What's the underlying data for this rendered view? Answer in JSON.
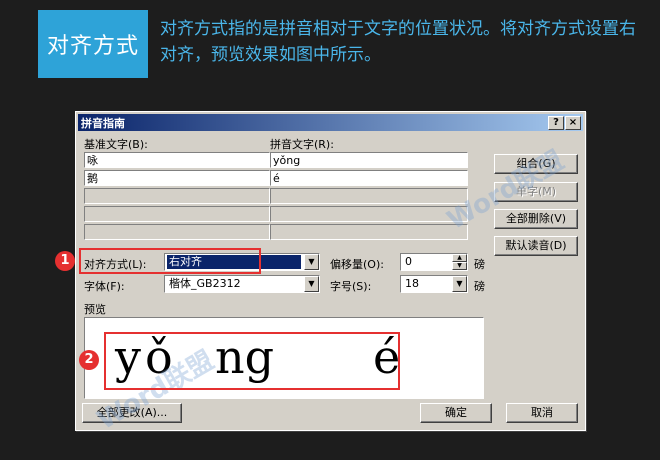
{
  "banner": {
    "tag": "对齐方式",
    "description": "对齐方式指的是拼音相对于文字的位置状况。将对齐方式设置右对齐，预览效果如图中所示。"
  },
  "dialog": {
    "title": "拼音指南",
    "help_btn": "?",
    "close_btn": "×",
    "base_text_header": "基准文字(B):",
    "ruby_text_header": "拼音文字(R):",
    "rows": [
      {
        "base": "咏",
        "ruby": "yǒng"
      },
      {
        "base": "鹅",
        "ruby": "é"
      }
    ],
    "buttons": {
      "combine": "组合(G)",
      "single": "单字(M)",
      "clear_all": "全部删除(V)",
      "default_reading": "默认读音(D)",
      "change_all": "全部更改(A)...",
      "ok": "确定",
      "cancel": "取消"
    },
    "alignment": {
      "label": "对齐方式(L):",
      "value": "右对齐"
    },
    "offset": {
      "label": "偏移量(O):",
      "value": "0",
      "unit": "磅"
    },
    "font": {
      "label": "字体(F):",
      "value": "楷体_GB2312"
    },
    "size": {
      "label": "字号(S):",
      "value": "18",
      "unit": "磅"
    },
    "preview": {
      "label": "预览",
      "syllables": [
        "y",
        "ǒ",
        "ng",
        "é"
      ]
    }
  },
  "markers": [
    "1",
    "2"
  ],
  "watermark": "Word联盟"
}
